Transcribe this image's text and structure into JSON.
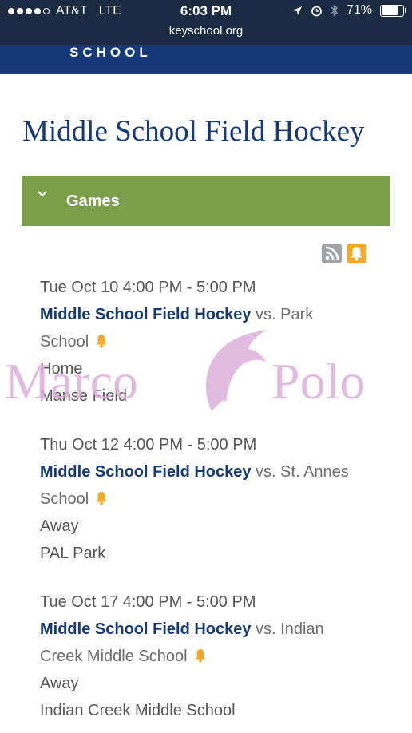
{
  "status_bar": {
    "carrier": "AT&T",
    "network": "LTE",
    "time": "6:03 PM",
    "battery": "71%",
    "battery_level": 0.71,
    "url": "keyschool.org"
  },
  "header": {
    "school_word": "SCHOOL"
  },
  "page": {
    "title": "Middle School Field Hockey"
  },
  "section": {
    "label": "Games",
    "chevron_icon": "chevron-down-icon",
    "color": "#7a9f4a"
  },
  "feeds": {
    "rss_icon": "rss-icon",
    "alert_icon": "bell-icon"
  },
  "events": [
    {
      "datetime": "Tue Oct 10 4:00 PM - 5:00 PM",
      "title": "Middle School Field Hockey",
      "vs_line1": " vs. Park",
      "vs_line2": "School",
      "home_away": "Home",
      "location": "Manse Field"
    },
    {
      "datetime": "Thu Oct 12 4:00 PM - 5:00 PM",
      "title": "Middle School Field Hockey",
      "vs_line1": " vs. St. Annes",
      "vs_line2": "School",
      "home_away": "Away",
      "location": "PAL Park"
    },
    {
      "datetime": "Tue Oct 17 4:00 PM - 5:00 PM",
      "title": "Middle School Field Hockey",
      "vs_line1": " vs. Indian",
      "vs_line2": "Creek Middle School",
      "home_away": "Away",
      "location": "Indian Creek Middle School"
    }
  ],
  "watermark": {
    "left": "Marco",
    "right": "Polo"
  }
}
